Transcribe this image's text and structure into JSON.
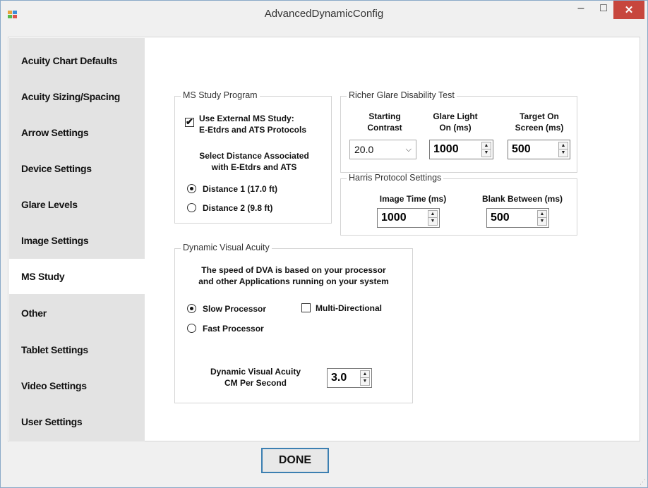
{
  "window": {
    "title": "AdvancedDynamicConfig",
    "minimize_glyph": "–",
    "maximize_glyph": "□",
    "close_glyph": "✕"
  },
  "sidebar": {
    "items": [
      {
        "label": "Acuity Chart Defaults",
        "active": false
      },
      {
        "label": "Acuity Sizing/Spacing",
        "active": false
      },
      {
        "label": "Arrow Settings",
        "active": false
      },
      {
        "label": "Device Settings",
        "active": false
      },
      {
        "label": "Glare Levels",
        "active": false
      },
      {
        "label": "Image Settings",
        "active": false
      },
      {
        "label": "MS Study",
        "active": true
      },
      {
        "label": "Other",
        "active": false
      },
      {
        "label": "Tablet Settings",
        "active": false
      },
      {
        "label": "Video Settings",
        "active": false
      },
      {
        "label": "User Settings",
        "active": false
      }
    ]
  },
  "ms_study": {
    "title": "MS Study Program",
    "use_external_line1": "Use External MS Study:",
    "use_external_line2": "E-Etdrs and ATS Protocols",
    "use_external_checked": true,
    "select_distance_line1": "Select Distance Associated",
    "select_distance_line2": "with E-Etdrs and ATS",
    "distance1": "Distance 1 (17.0 ft)",
    "distance2": "Distance 2 (9.8 ft)",
    "selected_distance": 1
  },
  "glare": {
    "title": "Richer Glare Disability Test",
    "starting_contrast_line1": "Starting",
    "starting_contrast_line2": "Contrast",
    "glare_light_line1": "Glare Light",
    "glare_light_line2": "On (ms)",
    "target_line1": "Target On",
    "target_line2": "Screen (ms)",
    "contrast_value": "20.0",
    "glare_light_value": "1000",
    "target_value": "500"
  },
  "harris": {
    "title": "Harris Protocol Settings",
    "image_time_label": "Image Time (ms)",
    "blank_between_label": "Blank Between (ms)",
    "image_time_value": "1000",
    "blank_between_value": "500"
  },
  "dva": {
    "title": "Dynamic Visual Acuity",
    "info_line1": "The speed of DVA is based on your processor",
    "info_line2": "and other Applications running on your system",
    "slow_processor": "Slow Processor",
    "fast_processor": "Fast Processor",
    "multi_directional": "Multi-Directional",
    "multi_directional_checked": false,
    "selected_processor": "slow",
    "cm_label_line1": "Dynamic Visual Acuity",
    "cm_label_line2": "CM Per Second",
    "cm_value": "3.0"
  },
  "footer": {
    "done_label": "DONE"
  },
  "spinner_glyphs": {
    "up": "▲",
    "down": "▼"
  },
  "combo_glyph": "⌵"
}
